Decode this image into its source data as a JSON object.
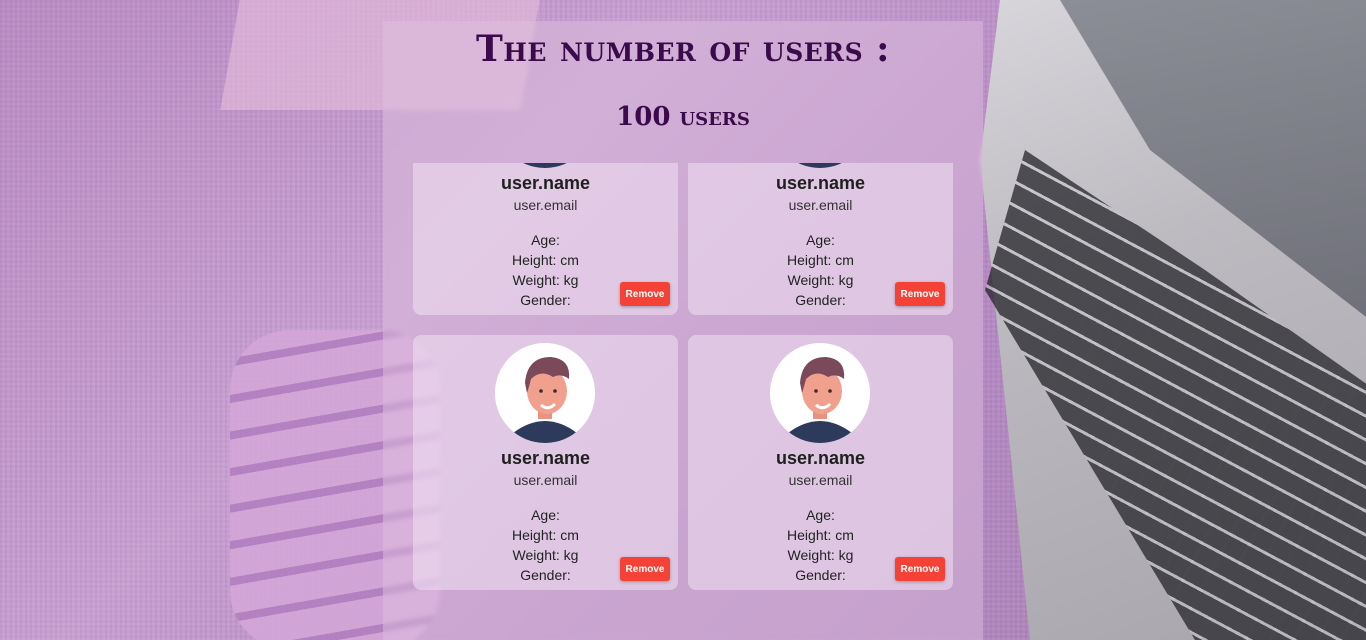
{
  "header": {
    "title": "The number of users :",
    "count_label": "100 users"
  },
  "users": [
    {
      "name": "user.name",
      "email": "user.email",
      "age": "Age:",
      "height": "Height:  cm",
      "weight": "Weight:  kg",
      "gender": "Gender:",
      "remove_label": "Remove"
    },
    {
      "name": "user.name",
      "email": "user.email",
      "age": "Age:",
      "height": "Height:  cm",
      "weight": "Weight:  kg",
      "gender": "Gender:",
      "remove_label": "Remove"
    },
    {
      "name": "user.name",
      "email": "user.email",
      "age": "Age:",
      "height": "Height:  cm",
      "weight": "Weight:  kg",
      "gender": "Gender:",
      "remove_label": "Remove"
    },
    {
      "name": "user.name",
      "email": "user.email",
      "age": "Age:",
      "height": "Height:  cm",
      "weight": "Weight:  kg",
      "gender": "Gender:",
      "remove_label": "Remove"
    }
  ],
  "colors": {
    "title": "#3a0a4a",
    "remove_button": "#f44336"
  },
  "icons": {
    "avatar": "user-avatar-illustration"
  }
}
